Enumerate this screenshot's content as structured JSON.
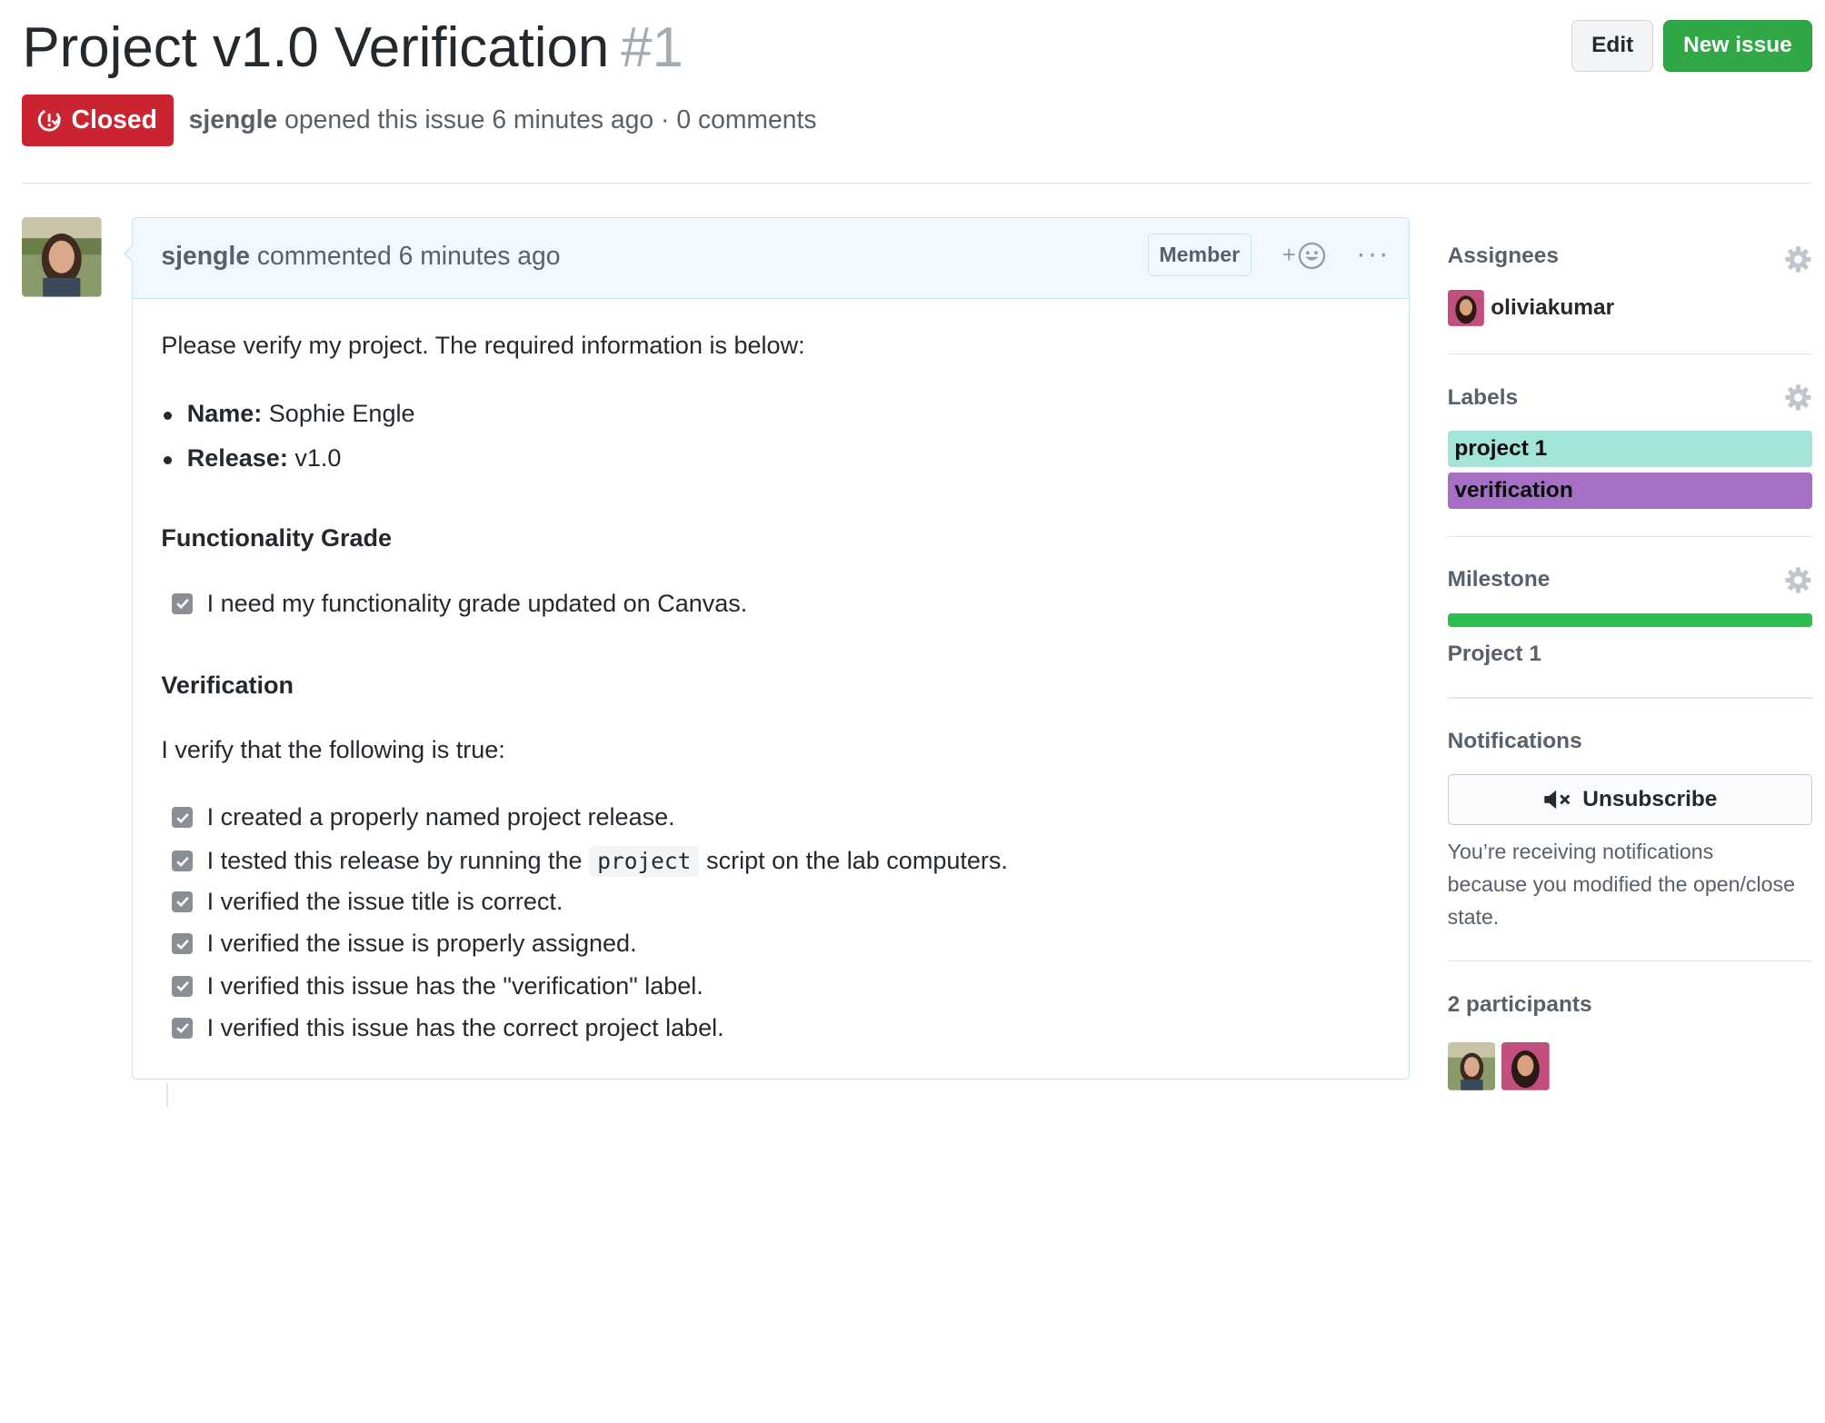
{
  "issue": {
    "title": "Project v1.0 Verification",
    "number": "#1",
    "state": "Closed",
    "author": "sjengle",
    "meta": "opened this issue 6 minutes ago · 0 comments"
  },
  "header_buttons": {
    "edit": "Edit",
    "new_issue": "New issue"
  },
  "comment": {
    "author": "sjengle",
    "action": "commented 6 minutes ago",
    "role_badge": "Member",
    "intro": "Please verify my project. The required information is below:",
    "fields": [
      {
        "key": "Name:",
        "value": "Sophie Engle"
      },
      {
        "key": "Release:",
        "value": "v1.0"
      }
    ],
    "functionality_heading": "Functionality Grade",
    "functionality_task": "I need my functionality grade updated on Canvas.",
    "verification_heading": "Verification",
    "verification_intro": "I verify that the following is true:",
    "tasks": {
      "t1": "I created a properly named project release.",
      "t2_before": "I tested this release by running the",
      "t2_code": "project",
      "t2_after": "script on the lab computers.",
      "t3": "I verified the issue title is correct.",
      "t4": "I verified the issue is properly assigned.",
      "t5": "I verified this issue has the \"verification\" label.",
      "t6": "I verified this issue has the correct project label."
    }
  },
  "sidebar": {
    "assignees_title": "Assignees",
    "assignee": "oliviakumar",
    "labels_title": "Labels",
    "labels": [
      {
        "name": "project 1",
        "color": "#a2e4d7"
      },
      {
        "name": "verification",
        "color": "#a46fc4"
      }
    ],
    "milestone_title": "Milestone",
    "milestone_progress": 1.0,
    "milestone_name": "Project 1",
    "notifications_title": "Notifications",
    "unsubscribe": "Unsubscribe",
    "notification_note": "You’re receiving notifications because you modified the open/close state.",
    "participants_title": "2 participants"
  },
  "colors": {
    "closed": "#cb2431",
    "new_issue": "#2fa845",
    "progress": "#2cbe4e"
  }
}
